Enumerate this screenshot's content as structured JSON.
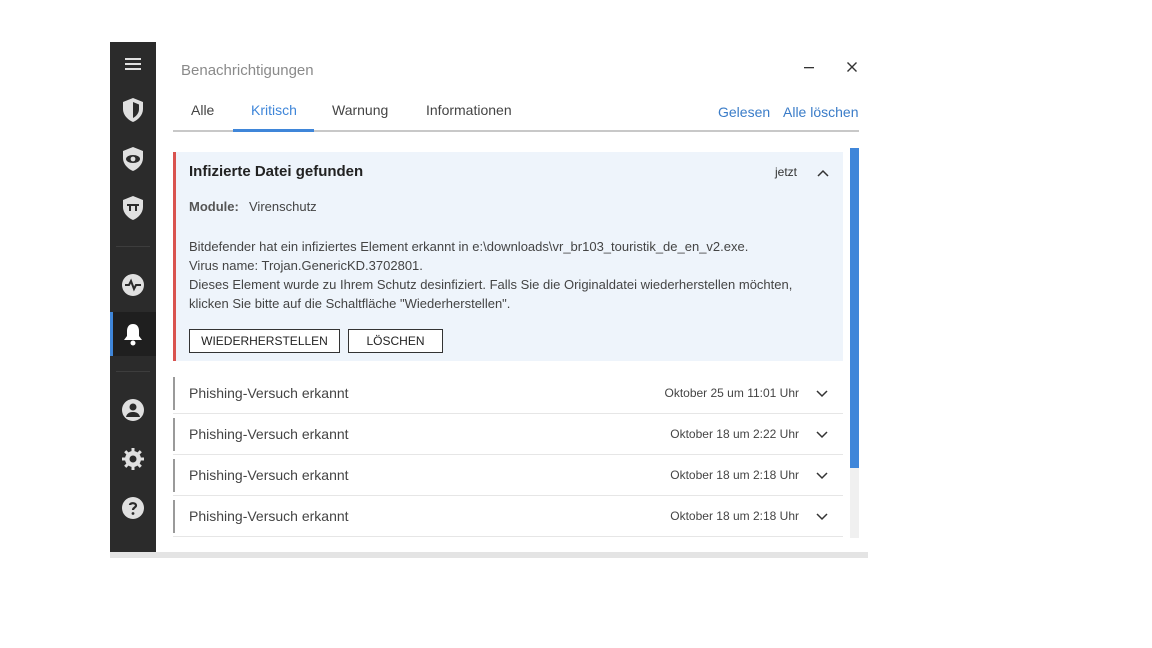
{
  "window": {
    "title": "Benachrichtigungen",
    "minimize_label": "–",
    "close_label": "✕"
  },
  "sidebar": {
    "items": [
      {
        "icon": "menu-icon"
      },
      {
        "icon": "shield-protection-icon"
      },
      {
        "icon": "privacy-eye-icon"
      },
      {
        "icon": "utilities-shield-icon"
      },
      {
        "icon": "activity-icon"
      },
      {
        "icon": "bell-icon",
        "active": true
      },
      {
        "icon": "account-icon"
      },
      {
        "icon": "gear-icon"
      },
      {
        "icon": "help-icon"
      }
    ]
  },
  "tabs": [
    {
      "label": "Alle",
      "active": false
    },
    {
      "label": "Kritisch",
      "active": true
    },
    {
      "label": "Warnung",
      "active": false
    },
    {
      "label": "Informationen",
      "active": false
    }
  ],
  "actions": {
    "read_label": "Gelesen",
    "clear_all_label": "Alle löschen"
  },
  "expanded_notification": {
    "title": "Infizierte Datei gefunden",
    "time": "jetzt",
    "module_label": "Module:",
    "module_value": "Virenschutz",
    "body_lines": [
      "Bitdefender hat ein infiziertes Element erkannt in e:\\downloads\\vr_br103_touristik_de_en_v2.exe.",
      "Virus name: Trojan.GenericKD.3702801.",
      "Dieses Element wurde zu Ihrem Schutz desinfiziert. Falls Sie die Originaldatei wiederherstellen möchten,",
      "klicken Sie bitte auf die Schaltfläche \"Wiederherstellen\"."
    ],
    "restore_button": "WIEDERHERSTELLEN",
    "delete_button": "LÖSCHEN"
  },
  "notifications": [
    {
      "title": "Phishing-Versuch erkannt",
      "time": "Oktober 25 um 11:01 Uhr"
    },
    {
      "title": "Phishing-Versuch erkannt",
      "time": "Oktober 18 um 2:22 Uhr"
    },
    {
      "title": "Phishing-Versuch erkannt",
      "time": "Oktober 18 um 2:18 Uhr"
    },
    {
      "title": "Phishing-Versuch erkannt",
      "time": "Oktober 18 um 2:18 Uhr"
    }
  ],
  "colors": {
    "accent": "#3f86d9",
    "critical": "#d9534f",
    "sidebar": "#2b2b2b"
  }
}
